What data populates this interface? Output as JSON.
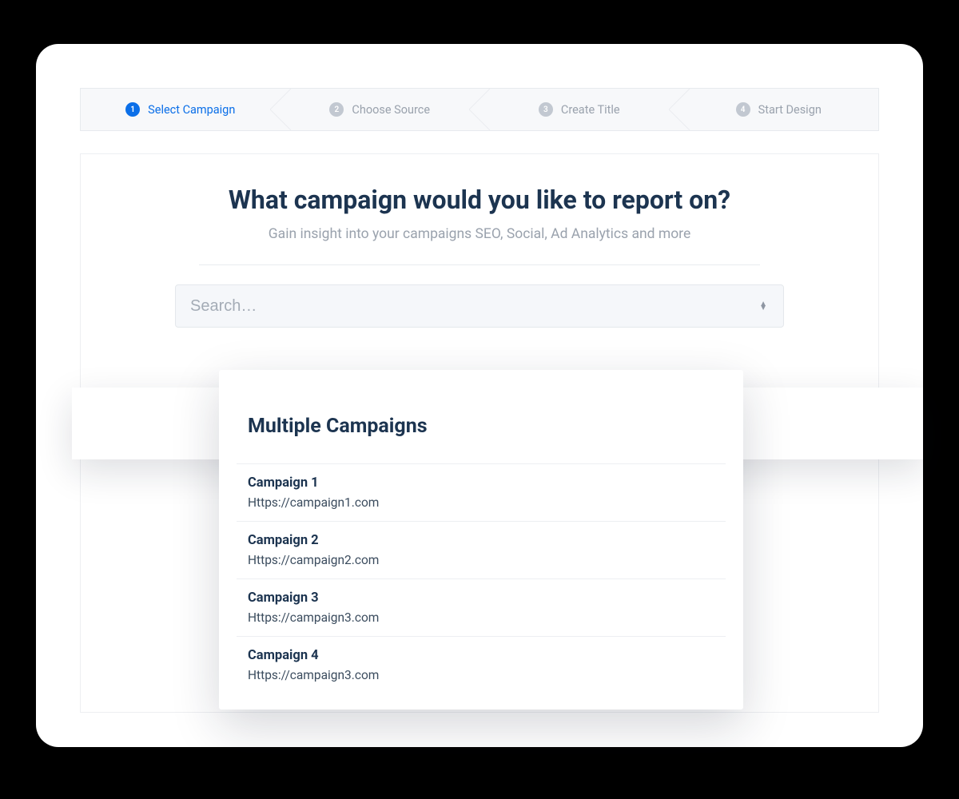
{
  "stepper": {
    "steps": [
      {
        "num": "1",
        "label": "Select Campaign",
        "active": true
      },
      {
        "num": "2",
        "label": "Choose Source",
        "active": false
      },
      {
        "num": "3",
        "label": "Create Title",
        "active": false
      },
      {
        "num": "4",
        "label": "Start Design",
        "active": false
      }
    ]
  },
  "panel": {
    "heading": "What campaign would you like to report on?",
    "subheading": "Gain insight into your campaigns SEO, Social, Ad Analytics and more"
  },
  "search": {
    "placeholder": "Search…"
  },
  "dropdown": {
    "title": "Multiple Campaigns",
    "options": [
      {
        "name": "Campaign 1",
        "url": "Https://campaign1.com"
      },
      {
        "name": "Campaign 2",
        "url": "Https://campaign2.com"
      },
      {
        "name": "Campaign 3",
        "url": "Https://campaign3.com"
      },
      {
        "name": "Campaign 4",
        "url": "Https://campaign3.com"
      }
    ]
  }
}
